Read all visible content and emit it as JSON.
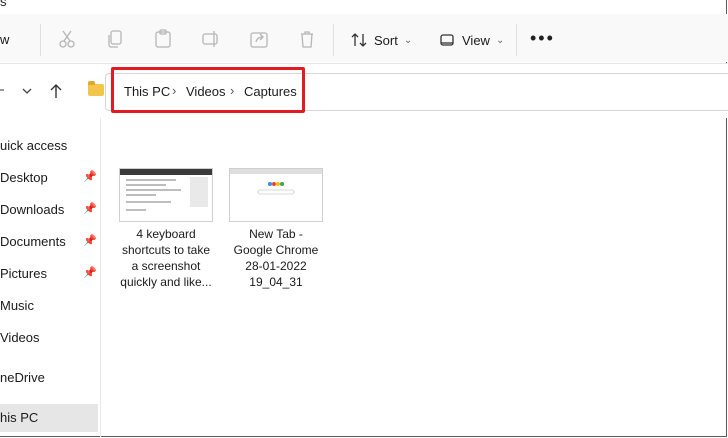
{
  "window": {
    "title_fragment": "s"
  },
  "toolbar": {
    "new_fragment": "w",
    "sort_label": "Sort",
    "view_label": "View",
    "more_label": "•••"
  },
  "address": {
    "crumbs": [
      "This PC",
      "Videos",
      "Captures"
    ],
    "separator": "›"
  },
  "sidebar": {
    "items": [
      {
        "label": "uick access",
        "pinned": false
      },
      {
        "label": "Desktop",
        "pinned": true
      },
      {
        "label": "Downloads",
        "pinned": true
      },
      {
        "label": "Documents",
        "pinned": true
      },
      {
        "label": "Pictures",
        "pinned": true
      },
      {
        "label": "Music",
        "pinned": false
      },
      {
        "label": "Videos",
        "pinned": false
      },
      {
        "label": "neDrive",
        "pinned": false
      },
      {
        "label": "his PC",
        "pinned": false,
        "selected": true
      }
    ]
  },
  "files": [
    {
      "name_lines": [
        "4 keyboard",
        "shortcuts to take",
        "a screenshot",
        "quickly and like..."
      ]
    },
    {
      "name_lines": [
        "New Tab -",
        "Google Chrome",
        "28-01-2022",
        "19_04_31"
      ]
    }
  ],
  "colors": {
    "highlight_box": "#e21b23",
    "folder": "#f4c54b",
    "selected_bg": "#e6e6e6"
  }
}
